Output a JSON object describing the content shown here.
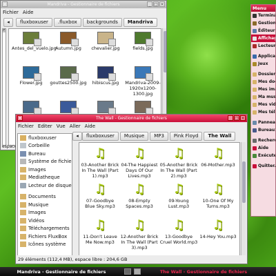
{
  "back_window": {
    "title": "Mandriva - Gestionnaire de fichiers",
    "menu": [
      "Fichier",
      "Aide"
    ],
    "path": [
      "fluxboxuser",
      ".fluxbox",
      "backgrounds",
      "Mandriva"
    ],
    "files": [
      {
        "name": "Antes_del_vuelo.jpg",
        "color": "#6b7d3a"
      },
      {
        "name": "Autumn.jpg",
        "color": "#8a5a2a"
      },
      {
        "name": "chevalier.jpg",
        "color": "#c9b48a"
      },
      {
        "name": "fields.jpg",
        "color": "#4f7a2e"
      },
      {
        "name": "Flower.jpg",
        "color": "#2e6b9a"
      },
      {
        "name": "gouttes2500.jpg",
        "color": "#5a6a4a"
      },
      {
        "name": "hibiscus.jpg",
        "color": "#2a3a6a"
      },
      {
        "name": "Mandriva-2009-1920x1200-1300.jpg",
        "color": "#3a78b8"
      },
      {
        "name": "",
        "color": "#4a6a8a"
      },
      {
        "name": "",
        "color": "#3a5a9a"
      },
      {
        "name": "",
        "color": "#6a7a8a"
      },
      {
        "name": "",
        "color": "#7a6a5a"
      }
    ],
    "side_fragment_top": "fl",
    "side_fragment_mid": [
      "M",
      "Pl",
      "M"
    ],
    "status_fragment": "espace libre : 2"
  },
  "front_window": {
    "title": "The Wall - Gestionnaire de fichiers",
    "menu": [
      "Fichier",
      "Editer",
      "Vue",
      "Aller",
      "Aide"
    ],
    "path": [
      "fluxboxuser",
      "Musique",
      "MP3",
      "Pink Floyd",
      "The Wall"
    ],
    "places": [
      {
        "label": "fluxboxuser",
        "icon": "home-folder-icon",
        "cls": "ic-home"
      },
      {
        "label": "Corbeille",
        "icon": "trash-icon",
        "cls": "ic-trash"
      },
      {
        "label": "Bureau",
        "icon": "desktop-icon",
        "cls": "ic-desk"
      },
      {
        "label": "Système de fichiers",
        "icon": "filesystem-icon",
        "cls": "ic-sys"
      },
      {
        "label": "Images",
        "icon": "folder-icon",
        "cls": "ic-folder"
      },
      {
        "label": "Mediatheque",
        "icon": "folder-icon",
        "cls": "ic-folder"
      },
      {
        "label": "Lecteur de disque...",
        "icon": "disc-drive-icon",
        "cls": "ic-cd"
      }
    ],
    "bookmarks": [
      {
        "label": "Documents",
        "icon": "folder-icon",
        "cls": "ic-folder"
      },
      {
        "label": "Musique",
        "icon": "folder-icon",
        "cls": "ic-folder"
      },
      {
        "label": "Images",
        "icon": "folder-icon",
        "cls": "ic-folder"
      },
      {
        "label": "Vidéos",
        "icon": "folder-icon",
        "cls": "ic-folder"
      },
      {
        "label": "Téléchargements",
        "icon": "folder-icon",
        "cls": "ic-folder"
      },
      {
        "label": "Fichiers FluxBox",
        "icon": "folder-icon",
        "cls": "ic-folder"
      },
      {
        "label": "Icônes système",
        "icon": "folder-icon",
        "cls": "ic-folder"
      }
    ],
    "files": [
      "03-Another Brick In The Wall (Part 1).mp3",
      "04-The Happiest Days Of Our Lives.mp3",
      "05-Another Brick In The Wall (Part 2).mp3",
      "06-Mother.mp3",
      "07-Goodbye Blue Sky.mp3",
      "08-Empty Spaces.mp3",
      "09-Young Lust.mp3",
      "10-One Of My Turns.mp3",
      "11-Don't Leave Me Now.mp3",
      "12-Another Brick In The Wall (Part 3).mp3",
      "13-Goodbye Cruel World.mp3",
      "14-Hey You.mp3"
    ],
    "status": "29 éléments (112,4 MB), espace libre : 204,6 GB"
  },
  "right_menu": {
    "title": "Menu",
    "groups": [
      [
        {
          "label": "Terminal",
          "color": "#333"
        },
        {
          "label": "Gestionnaire",
          "color": "#8a6a2a"
        },
        {
          "label": "Éditeur",
          "color": "#5a7aaa"
        },
        {
          "label": "Affichage",
          "color": "#e8e8e8",
          "selected": true
        },
        {
          "label": "Lecteur",
          "color": "#aa2a2a"
        }
      ],
      [
        {
          "label": "Applications",
          "color": "#3a6aaa"
        },
        {
          "label": "Jeux",
          "color": "#aa8a2a"
        }
      ],
      [
        {
          "label": "Dossier",
          "color": "#d7b36a"
        },
        {
          "label": "Mes documents",
          "color": "#d7b36a"
        },
        {
          "label": "Mes images",
          "color": "#d7b36a"
        },
        {
          "label": "Ma musique",
          "color": "#d7b36a"
        },
        {
          "label": "Mes vidéos",
          "color": "#d7b36a"
        },
        {
          "label": "Mes téléchargements",
          "color": "#d7b36a"
        }
      ],
      [
        {
          "label": "Panneau",
          "color": "#6a8aaa"
        },
        {
          "label": "Bureaux",
          "color": "#4a5a8a"
        }
      ],
      [
        {
          "label": "Rechercher",
          "color": "#6a6a6a"
        },
        {
          "label": "Aide",
          "color": "#c8103a"
        },
        {
          "label": "Exécuter",
          "color": "#4a8a3a"
        }
      ],
      [
        {
          "label": "Quitter...",
          "color": "#c8103a"
        }
      ]
    ]
  },
  "taskbar": {
    "left_task": "Mandriva - Gestionnaire de fichiers",
    "right_task": "The Wall - Gestionnaire de fichiers",
    "pages": 2,
    "current_page": 1
  },
  "colors": {
    "accent": "#c8103a",
    "music_icon": "#a8c810"
  }
}
